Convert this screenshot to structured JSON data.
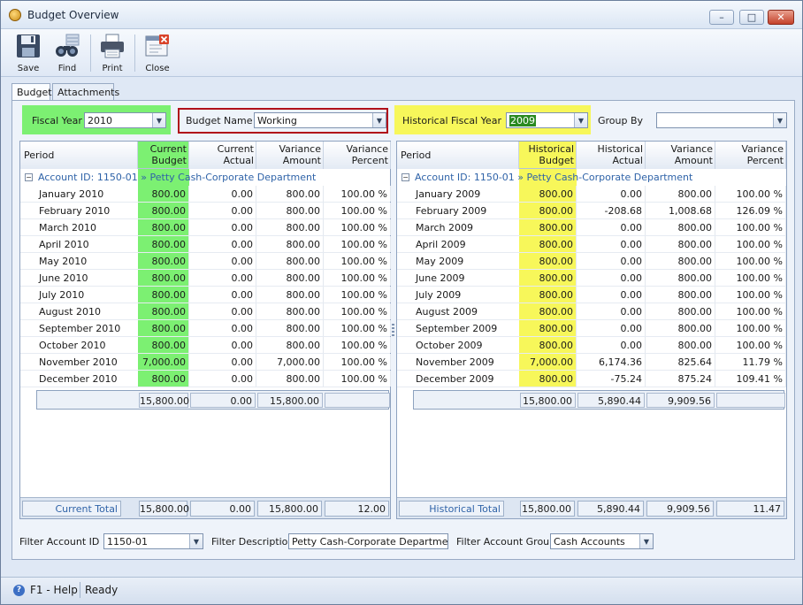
{
  "window": {
    "title": "Budget Overview",
    "controls": [
      "–",
      "□",
      "✕"
    ]
  },
  "toolbar": {
    "save": "Save",
    "find": "Find",
    "print": "Print",
    "close": "Close"
  },
  "tabs": [
    "Budget",
    "Attachments"
  ],
  "filters": {
    "fiscal_year_label": "Fiscal Year",
    "fiscal_year_value": "2010",
    "budget_name_label": "Budget Name",
    "budget_name_value": "Working",
    "historical_year_label": "Historical Fiscal Year",
    "historical_year_value": "2009",
    "group_by_label": "Group By",
    "group_by_value": ""
  },
  "current_grid": {
    "headers": [
      "Period",
      "Current\nBudget",
      "Current\nActual",
      "Variance\nAmount",
      "Variance\nPercent"
    ],
    "group": "Account ID: 1150-01 » Petty Cash-Corporate Department",
    "rows": [
      [
        "January 2010",
        "800.00",
        "0.00",
        "800.00",
        "100.00 %"
      ],
      [
        "February 2010",
        "800.00",
        "0.00",
        "800.00",
        "100.00 %"
      ],
      [
        "March 2010",
        "800.00",
        "0.00",
        "800.00",
        "100.00 %"
      ],
      [
        "April 2010",
        "800.00",
        "0.00",
        "800.00",
        "100.00 %"
      ],
      [
        "May 2010",
        "800.00",
        "0.00",
        "800.00",
        "100.00 %"
      ],
      [
        "June 2010",
        "800.00",
        "0.00",
        "800.00",
        "100.00 %"
      ],
      [
        "July 2010",
        "800.00",
        "0.00",
        "800.00",
        "100.00 %"
      ],
      [
        "August 2010",
        "800.00",
        "0.00",
        "800.00",
        "100.00 %"
      ],
      [
        "September 2010",
        "800.00",
        "0.00",
        "800.00",
        "100.00 %"
      ],
      [
        "October 2010",
        "800.00",
        "0.00",
        "800.00",
        "100.00 %"
      ],
      [
        "November 2010",
        "7,000.00",
        "0.00",
        "7,000.00",
        "100.00 %"
      ],
      [
        "December 2010",
        "800.00",
        "0.00",
        "800.00",
        "100.00 %"
      ]
    ],
    "subtotal": [
      "15,800.00",
      "0.00",
      "15,800.00",
      ""
    ],
    "total_label": "Current Total",
    "totals": [
      "15,800.00",
      "0.00",
      "15,800.00",
      "12.00"
    ]
  },
  "historical_grid": {
    "headers": [
      "Period",
      "Historical\nBudget",
      "Historical\nActual",
      "Variance\nAmount",
      "Variance\nPercent"
    ],
    "group": "Account ID: 1150-01 » Petty Cash-Corporate Department",
    "rows": [
      [
        "January 2009",
        "800.00",
        "0.00",
        "800.00",
        "100.00 %"
      ],
      [
        "February 2009",
        "800.00",
        "-208.68",
        "1,008.68",
        "126.09 %"
      ],
      [
        "March 2009",
        "800.00",
        "0.00",
        "800.00",
        "100.00 %"
      ],
      [
        "April 2009",
        "800.00",
        "0.00",
        "800.00",
        "100.00 %"
      ],
      [
        "May 2009",
        "800.00",
        "0.00",
        "800.00",
        "100.00 %"
      ],
      [
        "June 2009",
        "800.00",
        "0.00",
        "800.00",
        "100.00 %"
      ],
      [
        "July 2009",
        "800.00",
        "0.00",
        "800.00",
        "100.00 %"
      ],
      [
        "August 2009",
        "800.00",
        "0.00",
        "800.00",
        "100.00 %"
      ],
      [
        "September 2009",
        "800.00",
        "0.00",
        "800.00",
        "100.00 %"
      ],
      [
        "October 2009",
        "800.00",
        "0.00",
        "800.00",
        "100.00 %"
      ],
      [
        "November 2009",
        "7,000.00",
        "6,174.36",
        "825.64",
        "11.79 %"
      ],
      [
        "December 2009",
        "800.00",
        "-75.24",
        "875.24",
        "109.41 %"
      ]
    ],
    "subtotal": [
      "15,800.00",
      "5,890.44",
      "9,909.56",
      ""
    ],
    "total_label": "Historical Total",
    "totals": [
      "15,800.00",
      "5,890.44",
      "9,909.56",
      "11.47"
    ]
  },
  "bottom_filters": {
    "account_id_label": "Filter Account ID",
    "account_id_value": "1150-01",
    "description_label": "Filter Description",
    "description_value": "Petty Cash-Corporate Department",
    "account_group_label": "Filter Account Group",
    "account_group_value": "Cash Accounts"
  },
  "status": {
    "help": "F1 - Help",
    "state": "Ready"
  },
  "colors": {
    "current_highlight": "#7cf072",
    "historical_highlight": "#f7f75a",
    "budget_name_border": "#b0101a",
    "group_text": "#2f63a8"
  }
}
